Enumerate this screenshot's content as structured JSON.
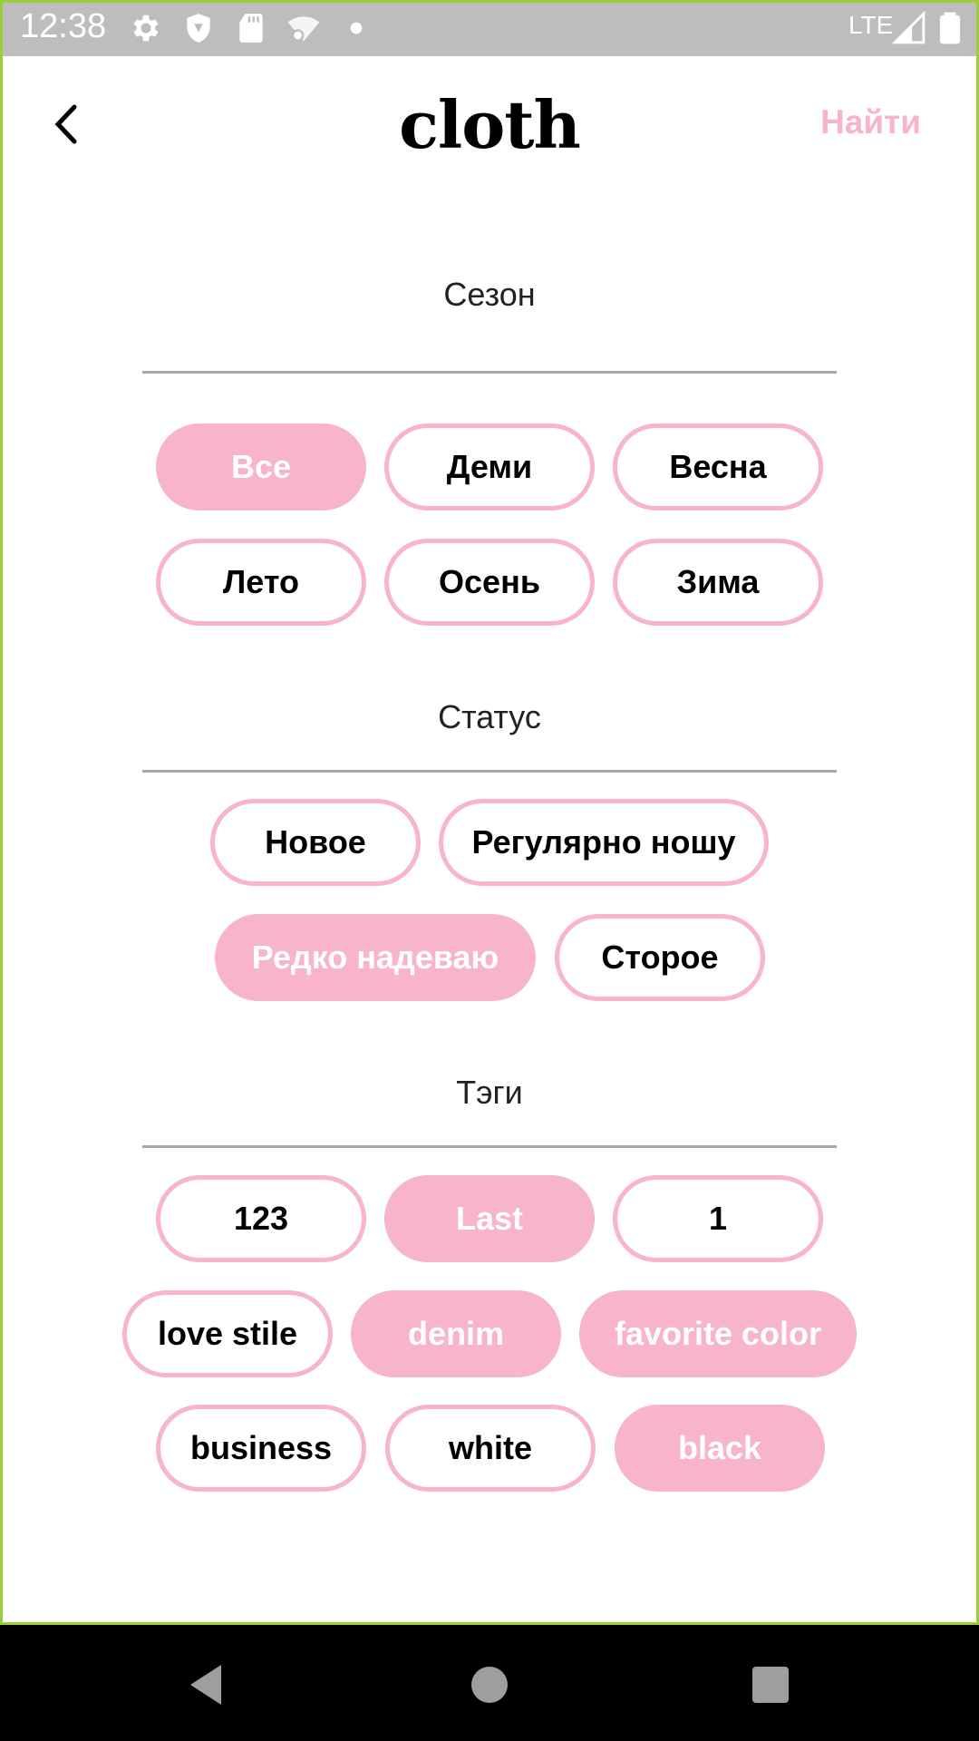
{
  "status_bar": {
    "time": "12:38",
    "network": "LTE",
    "icons": [
      "gear-icon",
      "shield-icon",
      "sd-card-icon",
      "wifi-settings-icon",
      "dot-icon",
      "signal-icon",
      "battery-icon"
    ]
  },
  "header": {
    "title": "cloth",
    "back_icon": "chevron-left-icon",
    "find_label": "Найти"
  },
  "colors": {
    "accent_pink": "#f8b4c8",
    "divider": "#a8a8a8",
    "frame_green": "#9ccc3a"
  },
  "season": {
    "title": "Сезон",
    "chips": [
      {
        "label": "Все",
        "selected": true
      },
      {
        "label": "Деми",
        "selected": false
      },
      {
        "label": "Весна",
        "selected": false
      },
      {
        "label": "Лето",
        "selected": false
      },
      {
        "label": "Осень",
        "selected": false
      },
      {
        "label": "Зима",
        "selected": false
      }
    ]
  },
  "status": {
    "title": "Статус",
    "chips": [
      {
        "label": "Новое",
        "selected": false
      },
      {
        "label": "Регулярно ношу",
        "selected": false
      },
      {
        "label": "Редко надеваю",
        "selected": true
      },
      {
        "label": "Сторое",
        "selected": false
      }
    ]
  },
  "tags": {
    "title": "Тэги",
    "chips": [
      {
        "label": "123",
        "selected": false
      },
      {
        "label": "Last",
        "selected": true
      },
      {
        "label": "1",
        "selected": false
      },
      {
        "label": "love stile",
        "selected": false
      },
      {
        "label": "denim",
        "selected": true
      },
      {
        "label": "favorite color",
        "selected": true
      },
      {
        "label": "business",
        "selected": false
      },
      {
        "label": "white",
        "selected": false
      },
      {
        "label": "black",
        "selected": true
      }
    ]
  },
  "nav_bar": {
    "icons": [
      "back-triangle-icon",
      "home-circle-icon",
      "recents-square-icon"
    ]
  }
}
